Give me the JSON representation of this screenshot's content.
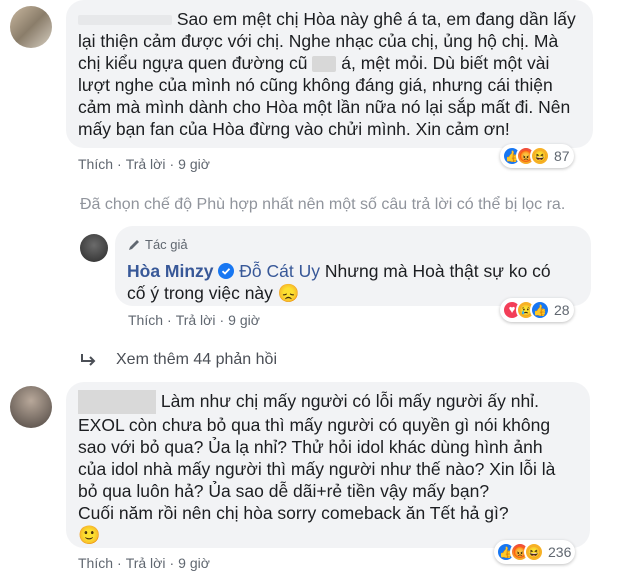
{
  "comment1": {
    "text_line1": "Sao em mệt chị Hòa này ghê á ta, em đang dần lấy",
    "text_lines": [
      "lại thiện cảm được với chị. Nghe nhạc của chị, ủng hộ chị. Mà",
      "chị kiểu ngựa quen đường cũ",
      "lượt nghe của mình nó cũng không đáng giá, nhưng cái thiện",
      "cảm mà mình dành cho Hòa một lần nữa nó lại sắp mất đi. Nên",
      "mấy bạn fan của Hòa đừng vào chửi mình. Xin cảm ơn!"
    ],
    "text_line3_tail": "á, mệt mỏi. Dù biết một vài",
    "like_label": "Thích",
    "reply_label": "Trả lời",
    "time": "9 giờ",
    "reaction_count": "87"
  },
  "filter_notice": "Đã chọn chế độ Phù hợp nhất nên một số câu trả lời có thể bị lọc ra.",
  "reply": {
    "author_badge": "Tác giả",
    "author_name": "Hòa Minzy",
    "mention": "Đỗ Cát Uy",
    "text_line1": "Nhưng mà Hoà thật sự ko có",
    "text_line2": "cố ý trong việc này",
    "like_label": "Thích",
    "reply_label": "Trả lời",
    "time": "9 giờ",
    "reaction_count": "28"
  },
  "view_more": "Xem thêm 44 phản hồi",
  "comment2": {
    "text_line1": "Làm như chị mấy người có lỗi mấy người ấy nhỉ.",
    "text_lines": [
      "EXOL còn chưa bỏ qua thì mấy người có quyền gì nói không",
      "sao với bỏ qua? Ủa lạ nhỉ? Thử hỏi idol khác dùng hình ảnh",
      "của idol nhà mấy người thì mấy người như thế nào? Xin lỗi là",
      "bỏ qua luôn hả? Ủa sao dễ dãi+rẻ tiền vậy mấy bạn?",
      "Cuối năm rồi nên chị hòa sorry comeback ăn Tết hả gì?"
    ],
    "like_label": "Thích",
    "reply_label": "Trả lời",
    "time": "9 giờ",
    "reaction_count": "236"
  },
  "colors": {
    "link": "#385898",
    "bubble": "#f2f3f5",
    "meta": "#606770",
    "like": "#1877f2"
  }
}
